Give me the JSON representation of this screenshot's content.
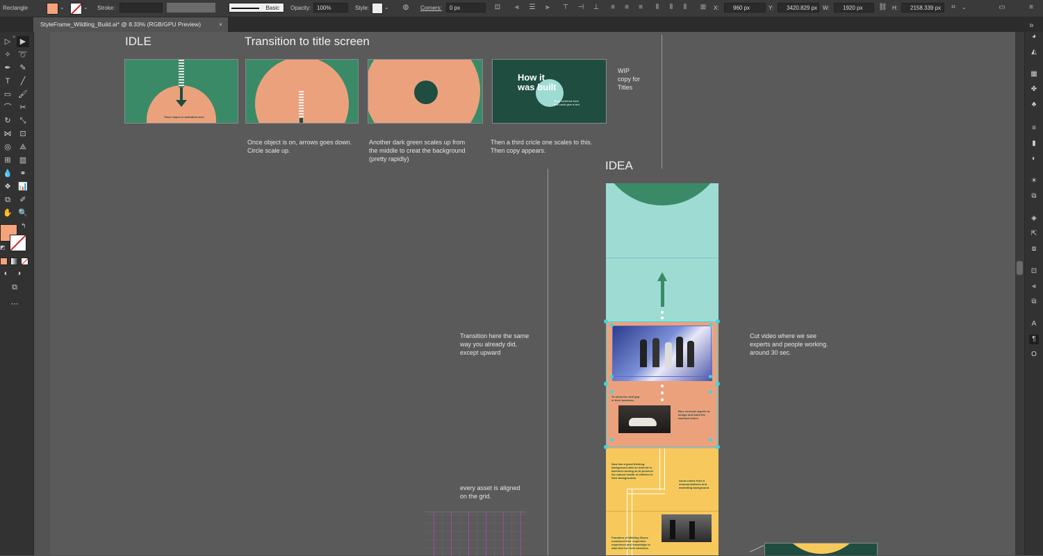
{
  "control_bar": {
    "object_type": "Rectangle",
    "stroke_label": "Stroke:",
    "stroke_style": "Basic",
    "opacity_label": "Opacity:",
    "opacity_value": "100%",
    "style_label": "Style:",
    "corners_label": "Corners:",
    "corners_value": "0 px",
    "x_label": "X:",
    "x_value": "960 px",
    "y_label": "Y:",
    "y_value": "3420.829 px",
    "w_label": "W:",
    "w_value": "1920 px",
    "h_label": "H:",
    "h_value": "2158.339 px",
    "fill_color": "#f4a37c"
  },
  "document_tab": {
    "title": "StyleFrame_Wildling_Build.ai* @ 8.33% (RGB/GPU Preview)",
    "close": "×"
  },
  "artboard": {
    "heading_idle": "IDLE",
    "heading_transition": "Transition to title screen",
    "heading_idea": "IDEA",
    "frame1_caption": "Place object in activation area",
    "frame4_title": "How it\nwas built",
    "frame4_subtitle": "Short sentence here\nthat could give a hint",
    "wip_note": "WIP\ncopy for\nTitles",
    "note1": "Once object is on, arrows goes down.\nCircle scale up.",
    "note2": "Another dark green scales up from\nthe middle to creat the background\n(pretty rapidly)",
    "note3": "Then a third  cricle one scales to this.\nThen copy appears.",
    "note_transition": "Transition here the same\nway you already did,\nexcept upward",
    "note_cut_video": "Cut video where we see\nexperts and people working.\naround 30 sec.",
    "note_grid": "every asset is aligned\non the grid.",
    "strip_text_1": "To show the skill gap\nin their business.",
    "strip_text_2": "Blue sourced experts to\ndesign and build the\nbarefoot shoes.",
    "strip_text_3": "Now has a good thinking\nbackground with an interest in\nbarefoot running as to preserve\nthe natural health of children in\ntheir backgrounds.",
    "strip_text_4": "Auna comes from a\ncommunications and\nmarketing background.",
    "strip_text_5": "Founders of Wildling Shoes\ncombined their respective\nexperience and knowledge to\nstart and run their business."
  },
  "colors": {
    "green": "#3a8a68",
    "dark_green": "#1f4d40",
    "salmon": "#eca17d",
    "mint": "#9edcd3",
    "yellow": "#f7c95c",
    "selection": "#3ed6e0"
  }
}
